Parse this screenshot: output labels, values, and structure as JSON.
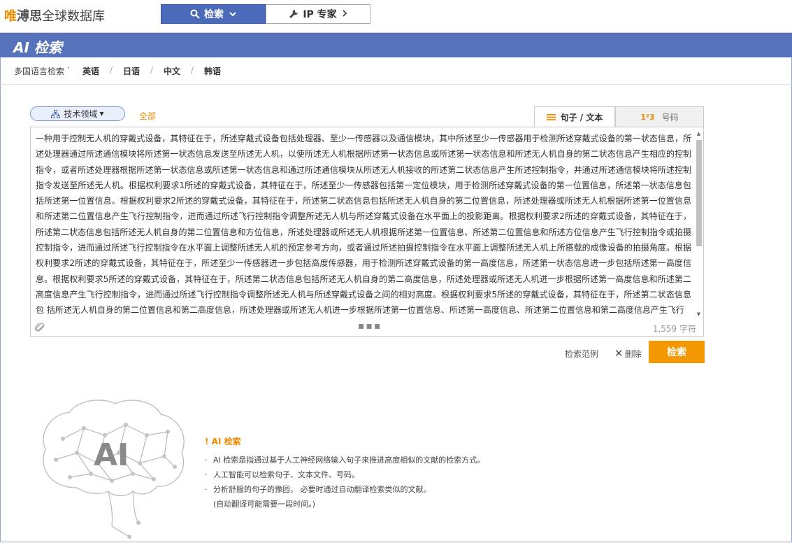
{
  "header": {
    "logo_part1": "唯",
    "logo_part2": "溥思",
    "logo_part3": "全球数据库",
    "nav_search_label": "检索",
    "nav_ip_label": "IP 专家"
  },
  "title_bar": {
    "title": "AI 检索"
  },
  "language_bar": {
    "lead_label": "多国语言检索",
    "languages": [
      "英语",
      "日语",
      "中文",
      "韩语"
    ],
    "separator": "/"
  },
  "search_panel": {
    "tech_field_label": "技术领域",
    "scope_label": "全部",
    "tabs": [
      {
        "label": "句子 / 文本",
        "active": true
      },
      {
        "label": "号码",
        "prefix": "1²3",
        "active": false
      }
    ],
    "query_text": "一种用于控制无人机的穿戴式设备，其特征在于，所述穿戴式设备包括处理器、至少一传感器以及通信模块，其中所述至少一传感器用于检测所述穿戴式设备的第一状态信息，所述处理器通过所述通信模块将所述第一状态信息发送至所述无人机，以使所述无人机根据所述第一状态信息或所述第一状态信息和所述无人机自身的第二状态信息产生相应的控制指令，或者所述处理器根据所述第一状态信息或所述第一状态信息和通过所述通信模块从所述无人机接收的所述第二状态信息产生所述控制指令，并通过所述通信模块将所述控制指令发送至所述无人机。根据权利要求1所述的穿戴式设备，其特征在于，所述至少一传感器包括第一定位模块，用于检测所述穿戴式设备的第一位置信息，所述第一状态信息包括所述第一位置信息。根据权利要求2所述的穿戴式设备，其特征在于，所述第二状态信息包括所述无人机自身的第二位置信息，所述处理器或所述无人机根据所述第一位置信息和所述第二位置信息产生飞行控制指令，进而通过所述飞行控制指令调整所述无人机与所述穿戴式设备在水平面上的投影距离。根据权利要求2所述的穿戴式设备，其特征在于，所述第二状态信息包括所述无人机自身的第二位置信息和方位信息，所述处理器或所述无人机根据所述第一位置信息、所述第二位置信息和所述方位信息产生飞行控制指令或拍摄控制指令，进而通过所述飞行控制指令在水平面上调整所述无人机的预定参考方向，或者通过所述拍摄控制指令在水平面上调整所述无人机上所搭载的成像设备的拍摄角度。根据权利要求2所述的穿戴式设备，其特征在于，所述至少一传感器进一步包括高度传感器，用于检测所述穿戴式设备的第一高度信息，所述第一状态信息进一步包括所述第一高度信息。根据权利要求5所述的穿戴式设备，其特征在于，所述第二状态信息包括所述无人机自身的第二高度信息，所述处理器或所述无人机进一步根据所述第一高度信息和所述第二高度信息产生飞行控制指令，进而通过所述飞行控制指令调整所述无人机与所述穿戴式设备之间的相对高度。根据权利要求5所述的穿戴式设备，其特征在于，所述第二状态信息包 括所述无人机自身的第二位置信息和第二高度信息，所述处理器或所述无人机进一步根据所述第一位置信息、所述第一高度信息、所述第二位置信息和第二高度信息产生飞行",
    "char_count": "1,559 字符",
    "example_link": "检索范例",
    "delete_link": "删除",
    "search_button": "检索"
  },
  "info": {
    "brain_text": "AI",
    "title": "! AI 检索",
    "items": [
      "AI 检索是指通过基于人工神经网络输入句子来推进高度相似的文献的检索方式。",
      "人工智能可以检索句子、文本文件、号码。",
      "分析舒服的句子的豫园， 必要时通过自动翻译检索类似的文献。"
    ],
    "note": "(自动翻译可能需要一段时间。)"
  },
  "colors": {
    "accent_orange": "#f39800",
    "brand_blue": "#5572ba",
    "nav_blue": "#4a69b8"
  }
}
